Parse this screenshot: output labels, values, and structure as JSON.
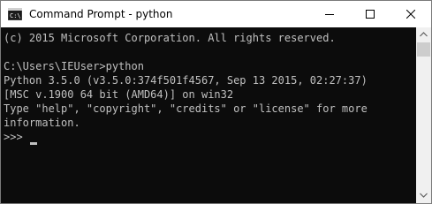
{
  "window": {
    "title": "Command Prompt - python",
    "icon": "cmd-icon"
  },
  "controls": {
    "minimize_icon": "minimize-icon",
    "maximize_icon": "maximize-icon",
    "close_icon": "close-icon"
  },
  "console": {
    "lines": [
      "(c) 2015 Microsoft Corporation. All rights reserved.",
      "",
      "C:\\Users\\IEUser>python",
      "Python 3.5.0 (v3.5.0:374f501f4567, Sep 13 2015, 02:27:37)",
      "[MSC v.1900 64 bit (AMD64)] on win32",
      "Type \"help\", \"copyright\", \"credits\" or \"license\" for more",
      "information.",
      ">>> "
    ],
    "background": "#0c0c0c",
    "foreground": "#c0c0c0"
  },
  "scrollbar": {
    "up_icon": "scroll-up-arrow-icon",
    "down_icon": "scroll-down-arrow-icon"
  }
}
